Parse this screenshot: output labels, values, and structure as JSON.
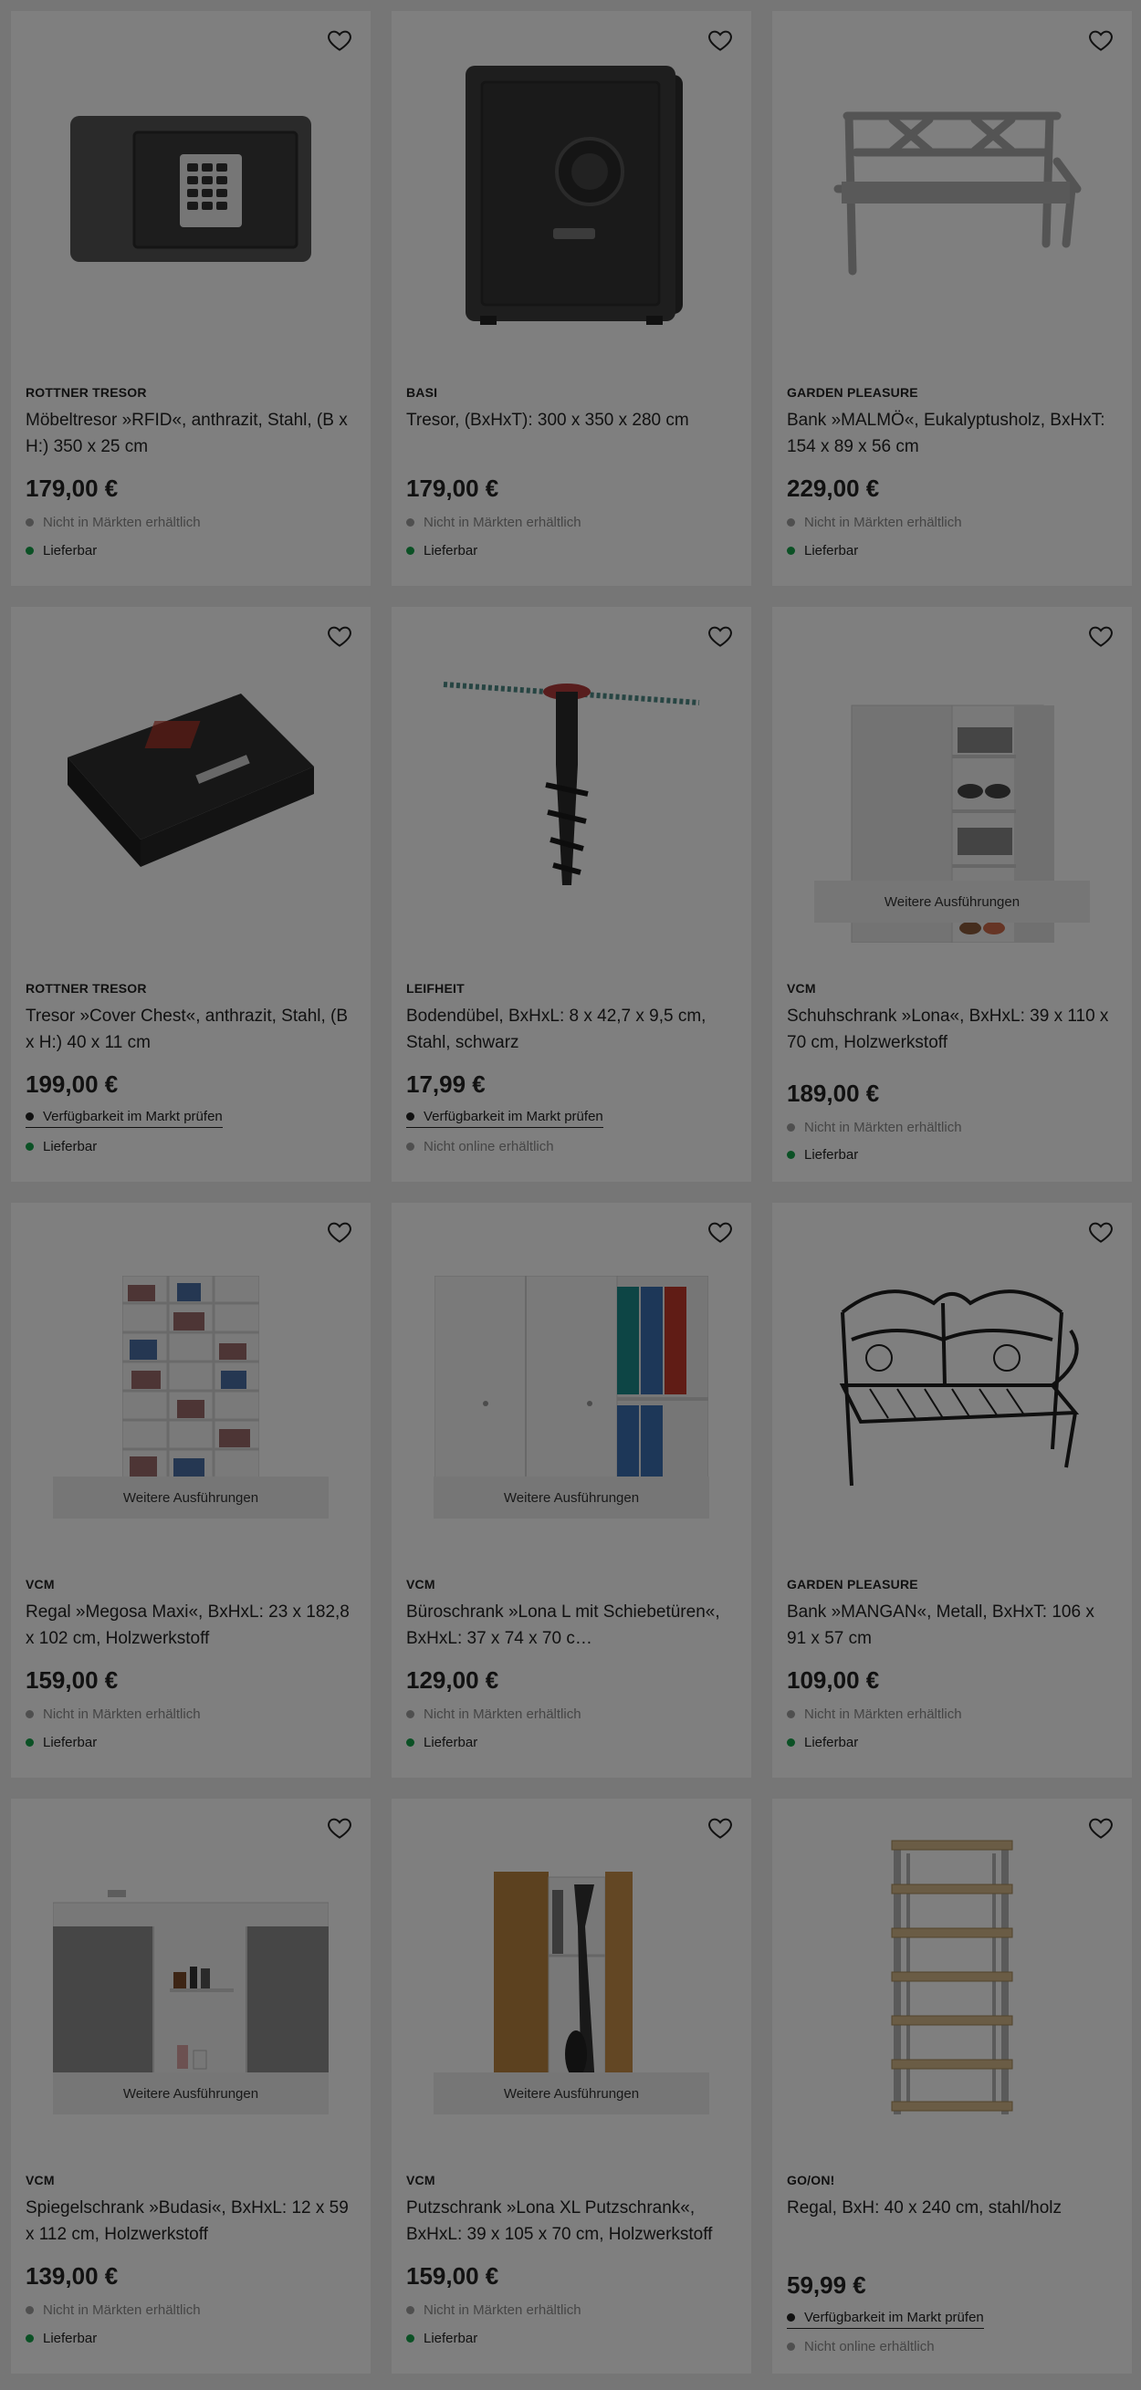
{
  "products": [
    {
      "brand": "ROTTNER TRESOR",
      "name": "Möbeltresor »RFID«, anthrazit, Stahl, (B x H:) 350 x 25 cm",
      "price": "179,00 €",
      "line1": "Nicht in Märkten erhältlich",
      "line2": "Lieferbar",
      "image": "safe-keypad"
    },
    {
      "brand": "BASI",
      "name": "Tresor, (BxHxT): 300 x 350 x 280 cm",
      "price": "179,00 €",
      "line1": "Nicht in Märkten erhältlich",
      "line2": "Lieferbar",
      "image": "safe-tall"
    },
    {
      "brand": "GARDEN PLEASURE",
      "name": "Bank »MALMÖ«, Eukalyptusholz, BxHxT: 154 x 89 x 56 cm",
      "price": "229,00 €",
      "line1": "Nicht in Märkten erhältlich",
      "line2": "Lieferbar",
      "image": "bench-wood"
    },
    {
      "brand": "ROTTNER TRESOR",
      "name": "Tresor »Cover Chest«, anthrazit, Stahl, (B x H:) 40 x 11 cm",
      "price": "199,00 €",
      "line1": "Verfügbarkeit im Markt prüfen",
      "line2": "Lieferbar",
      "image": "safe-chest"
    },
    {
      "brand": "LEIFHEIT",
      "name": "Bodendübel, BxHxL: 8 x 42,7 x 9,5 cm, Stahl, schwarz",
      "price": "17,99 €",
      "line1": "Verfügbarkeit im Markt prüfen",
      "line2": "Nicht online erhältlich",
      "image": "ground-anchor"
    },
    {
      "brand": "VCM",
      "name": "Schuhschrank »Lona«, BxHxL: 39 x 110 x 70 cm, Holzwerkstoff",
      "price": "189,00 €",
      "line1": "Nicht in Märkten erhältlich",
      "line2": "Lieferbar",
      "image": "shoe-cabinet",
      "variants": "Weitere Ausführungen"
    },
    {
      "brand": "VCM",
      "name": "Regal »Megosa Maxi«, BxHxL: 23 x 182,8 x 102 cm, Holzwerkstoff",
      "price": "159,00 €",
      "line1": "Nicht in Märkten erhältlich",
      "line2": "Lieferbar",
      "image": "media-shelf",
      "variants": "Weitere Ausführungen"
    },
    {
      "brand": "VCM",
      "name": "Büroschrank »Lona L mit Schiebetüren«, BxHxL: 37 x 74 x 70 c…",
      "price": "129,00 €",
      "line1": "Nicht in Märkten erhältlich",
      "line2": "Lieferbar",
      "image": "office-cabinet",
      "variants": "Weitere Ausführungen"
    },
    {
      "brand": "GARDEN PLEASURE",
      "name": "Bank »MANGAN«, Metall, BxHxT: 106 x 91 x 57 cm",
      "price": "109,00 €",
      "line1": "Nicht in Märkten erhältlich",
      "line2": "Lieferbar",
      "image": "bench-metal"
    },
    {
      "brand": "VCM",
      "name": "Spiegelschrank »Budasi«, BxHxL: 12 x 59 x 112 cm, Holzwerkstoff",
      "price": "139,00 €",
      "line1": "Nicht in Märkten erhältlich",
      "line2": "Lieferbar",
      "image": "mirror-cabinet",
      "variants": "Weitere Ausführungen"
    },
    {
      "brand": "VCM",
      "name": "Putzschrank »Lona XL Putzschrank«, BxHxL: 39 x 105 x 70 cm, Holzwerkstoff",
      "price": "159,00 €",
      "line1": "Nicht in Märkten erhältlich",
      "line2": "Lieferbar",
      "image": "cleaning-cabinet",
      "variants": "Weitere Ausführungen"
    },
    {
      "brand": "GO/ON!",
      "name": "Regal, BxH: 40 x 240 cm, stahl/holz",
      "price": "59,99 €",
      "line1": "Verfügbarkeit im Markt prüfen",
      "line2": "Nicht online erhältlich",
      "image": "steel-shelf"
    }
  ],
  "colors": {
    "available": "#17a34a",
    "unavailable": "#9e9e9e",
    "overlay": "rgba(0,0,0,0.5)"
  },
  "icons": {
    "wishlist": "heart-outline-icon"
  }
}
